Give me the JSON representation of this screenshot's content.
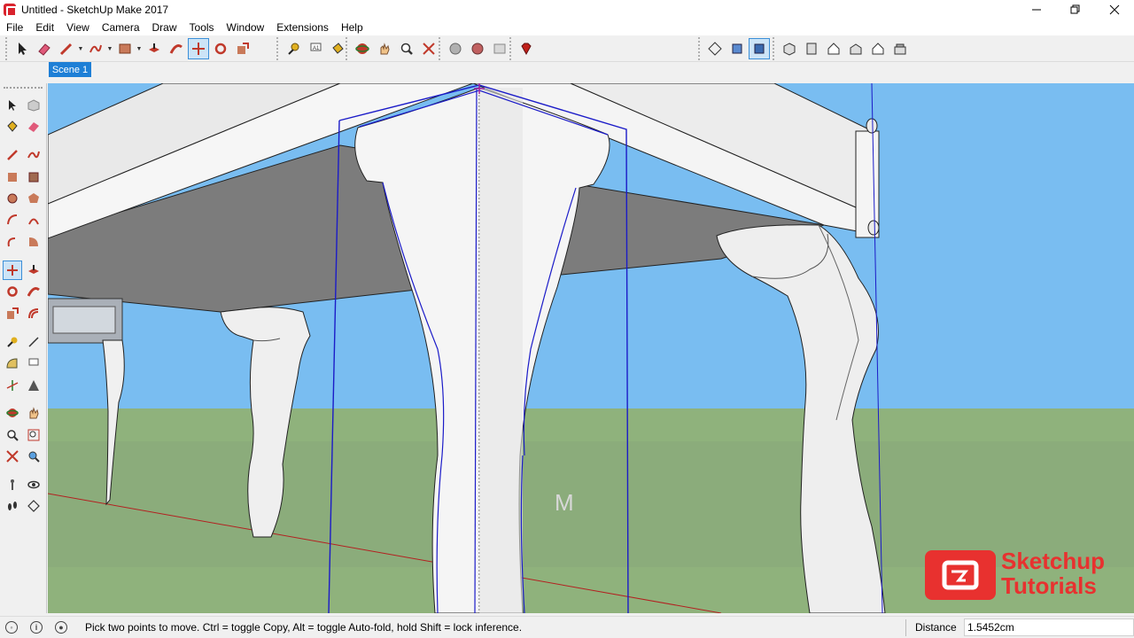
{
  "window": {
    "title": "Untitled - SketchUp Make 2017",
    "controls": [
      "minimize",
      "restore",
      "close"
    ]
  },
  "menu": [
    "File",
    "Edit",
    "View",
    "Camera",
    "Draw",
    "Tools",
    "Window",
    "Extensions",
    "Help"
  ],
  "toolbar": {
    "icons_main": [
      "select-icon",
      "eraser-icon",
      "pencil-icon",
      "freehand-icon",
      "rectangle-icon",
      "push-pull-icon",
      "follow-me-icon",
      "move-icon",
      "rotate-icon",
      "scale-icon",
      "tape-measure-icon",
      "text-icon",
      "paint-bucket-icon",
      "orbit-icon",
      "pan-icon",
      "zoom-icon",
      "zoom-extents-icon",
      "3d-warehouse-icon",
      "extension-warehouse-icon",
      "layout-icon",
      "ruby-icon"
    ],
    "icons_views": [
      "section-plane-icon",
      "display-section-planes-icon",
      "display-section-cuts-icon",
      "iso-view-icon",
      "top-view-icon",
      "front-view-icon",
      "right-view-icon",
      "back-view-icon",
      "left-view-icon"
    ],
    "active_tool": "move-icon"
  },
  "scenes": {
    "tabs": [
      "Scene 1"
    ]
  },
  "viewport": {
    "hint_letter": "M",
    "sky_color": "#79bdf1",
    "ground_color": "#8fb27c",
    "selection_color": "#1b1bc8",
    "axis_color": "#b32020"
  },
  "brand": {
    "line1": "Sketchup",
    "line2": "Tutorials",
    "color": "#e8312f"
  },
  "status": {
    "message": "Pick two points to move.  Ctrl = toggle Copy, Alt = toggle Auto-fold, hold Shift = lock inference.",
    "measure_label": "Distance",
    "measure_value": "1.5452cm"
  }
}
